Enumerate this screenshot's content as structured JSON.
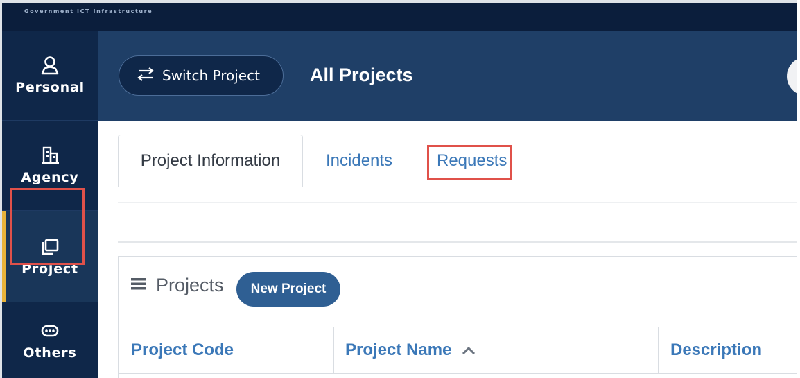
{
  "topbar": {
    "brand": "Government ICT Infrastructure"
  },
  "sidebar": {
    "items": [
      {
        "label": "Personal",
        "icon": "person-icon"
      },
      {
        "label": "Agency",
        "icon": "building-icon"
      },
      {
        "label": "Project",
        "icon": "folders-icon",
        "active": true
      },
      {
        "label": "Others",
        "icon": "ellipsis-icon"
      }
    ]
  },
  "header": {
    "switch_label": "Switch Project",
    "title": "All Projects"
  },
  "tabs": [
    {
      "label": "Project Information",
      "active": true
    },
    {
      "label": "Incidents"
    },
    {
      "label": "Requests"
    }
  ],
  "projects": {
    "title": "Projects",
    "new_button": "New Project",
    "columns": [
      "Project Code",
      "Project Name",
      "Description"
    ]
  },
  "colors": {
    "topbar": "#0b1e3c",
    "sidebar": "#0f2749",
    "header": "#1f3f67",
    "link": "#3b78b8",
    "active_accent": "#e8b33a",
    "highlight": "#e0514a",
    "button": "#2f5f93"
  }
}
